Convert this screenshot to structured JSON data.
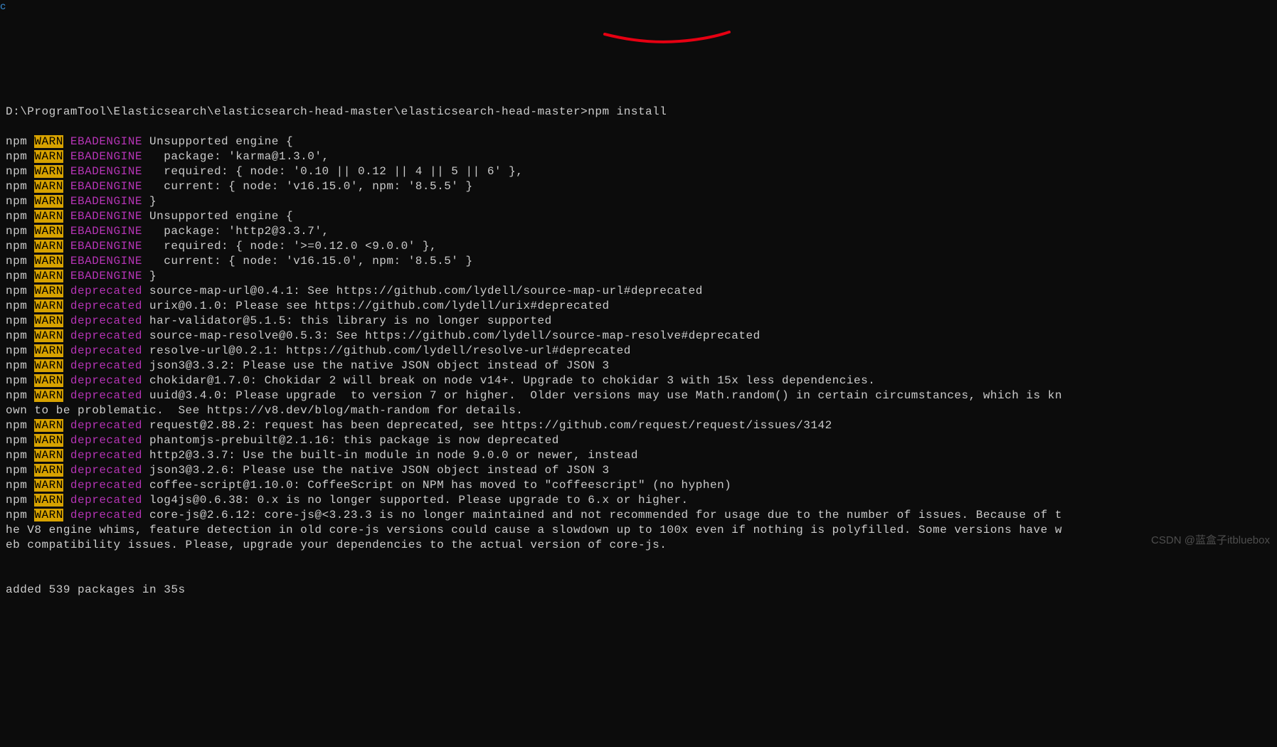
{
  "prompt_path": "D:\\ProgramTool\\Elasticsearch\\elasticsearch-head-master\\elasticsearch-head-master>",
  "prompt_cmd": "npm install",
  "lines": [
    {
      "pre": "npm ",
      "tag": "WARN",
      "code": "EBADENGINE",
      "msg": " Unsupported engine {"
    },
    {
      "pre": "npm ",
      "tag": "WARN",
      "code": "EBADENGINE",
      "msg": "   package: 'karma@1.3.0',"
    },
    {
      "pre": "npm ",
      "tag": "WARN",
      "code": "EBADENGINE",
      "msg": "   required: { node: '0.10 || 0.12 || 4 || 5 || 6' },"
    },
    {
      "pre": "npm ",
      "tag": "WARN",
      "code": "EBADENGINE",
      "msg": "   current: { node: 'v16.15.0', npm: '8.5.5' }"
    },
    {
      "pre": "npm ",
      "tag": "WARN",
      "code": "EBADENGINE",
      "msg": " }"
    },
    {
      "pre": "npm ",
      "tag": "WARN",
      "code": "EBADENGINE",
      "msg": " Unsupported engine {"
    },
    {
      "pre": "npm ",
      "tag": "WARN",
      "code": "EBADENGINE",
      "msg": "   package: 'http2@3.3.7',"
    },
    {
      "pre": "npm ",
      "tag": "WARN",
      "code": "EBADENGINE",
      "msg": "   required: { node: '>=0.12.0 <9.0.0' },"
    },
    {
      "pre": "npm ",
      "tag": "WARN",
      "code": "EBADENGINE",
      "msg": "   current: { node: 'v16.15.0', npm: '8.5.5' }"
    },
    {
      "pre": "npm ",
      "tag": "WARN",
      "code": "EBADENGINE",
      "msg": " }"
    },
    {
      "pre": "npm ",
      "tag": "WARN",
      "code": "deprecated",
      "msg": " source-map-url@0.4.1: See https://github.com/lydell/source-map-url#deprecated"
    },
    {
      "pre": "npm ",
      "tag": "WARN",
      "code": "deprecated",
      "msg": " urix@0.1.0: Please see https://github.com/lydell/urix#deprecated"
    },
    {
      "pre": "npm ",
      "tag": "WARN",
      "code": "deprecated",
      "msg": " har-validator@5.1.5: this library is no longer supported"
    },
    {
      "pre": "npm ",
      "tag": "WARN",
      "code": "deprecated",
      "msg": " source-map-resolve@0.5.3: See https://github.com/lydell/source-map-resolve#deprecated"
    },
    {
      "pre": "npm ",
      "tag": "WARN",
      "code": "deprecated",
      "msg": " resolve-url@0.2.1: https://github.com/lydell/resolve-url#deprecated"
    },
    {
      "pre": "npm ",
      "tag": "WARN",
      "code": "deprecated",
      "msg": " json3@3.3.2: Please use the native JSON object instead of JSON 3"
    },
    {
      "pre": "npm ",
      "tag": "WARN",
      "code": "deprecated",
      "msg": " chokidar@1.7.0: Chokidar 2 will break on node v14+. Upgrade to chokidar 3 with 15x less dependencies."
    },
    {
      "pre": "npm ",
      "tag": "WARN",
      "code": "deprecated",
      "msg": " uuid@3.4.0: Please upgrade  to version 7 or higher.  Older versions may use Math.random() in certain circumstances, which is kn"
    },
    {
      "pre": "",
      "tag": "",
      "code": "",
      "msg": "own to be problematic.  See https://v8.dev/blog/math-random for details."
    },
    {
      "pre": "npm ",
      "tag": "WARN",
      "code": "deprecated",
      "msg": " request@2.88.2: request has been deprecated, see https://github.com/request/request/issues/3142"
    },
    {
      "pre": "npm ",
      "tag": "WARN",
      "code": "deprecated",
      "msg": " phantomjs-prebuilt@2.1.16: this package is now deprecated"
    },
    {
      "pre": "npm ",
      "tag": "WARN",
      "code": "deprecated",
      "msg": " http2@3.3.7: Use the built-in module in node 9.0.0 or newer, instead"
    },
    {
      "pre": "npm ",
      "tag": "WARN",
      "code": "deprecated",
      "msg": " json3@3.2.6: Please use the native JSON object instead of JSON 3"
    },
    {
      "pre": "npm ",
      "tag": "WARN",
      "code": "deprecated",
      "msg": " coffee-script@1.10.0: CoffeeScript on NPM has moved to \"coffeescript\" (no hyphen)"
    },
    {
      "pre": "npm ",
      "tag": "WARN",
      "code": "deprecated",
      "msg": " log4js@0.6.38: 0.x is no longer supported. Please upgrade to 6.x or higher."
    },
    {
      "pre": "npm ",
      "tag": "WARN",
      "code": "deprecated",
      "msg": " core-js@2.6.12: core-js@<3.23.3 is no longer maintained and not recommended for usage due to the number of issues. Because of t"
    },
    {
      "pre": "",
      "tag": "",
      "code": "",
      "msg": "he V8 engine whims, feature detection in old core-js versions could cause a slowdown up to 100x even if nothing is polyfilled. Some versions have w"
    },
    {
      "pre": "",
      "tag": "",
      "code": "",
      "msg": "eb compatibility issues. Please, upgrade your dependencies to the actual version of core-js."
    }
  ],
  "footer_blank": "",
  "footer": "added 539 packages in 35s",
  "watermark": "CSDN @蓝盒子itbluebox"
}
